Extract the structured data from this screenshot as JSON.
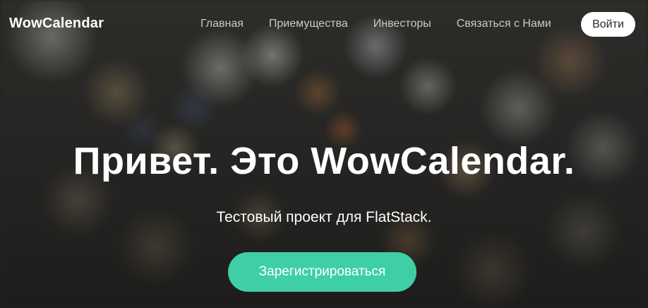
{
  "header": {
    "brand": "WowCalendar",
    "nav": [
      {
        "label": "Главная"
      },
      {
        "label": "Приемущества"
      },
      {
        "label": "Инвесторы"
      },
      {
        "label": "Связаться с Нами"
      }
    ],
    "login_label": "Войти"
  },
  "hero": {
    "title": "Привет. Это WowCalendar.",
    "subtitle": "Тестовый проект для FlatStack.",
    "cta_label": "Зарегистрироваться"
  },
  "colors": {
    "accent": "#3fcfa6",
    "nav_text": "#c9c9c9",
    "background": "#2a2a2a"
  }
}
